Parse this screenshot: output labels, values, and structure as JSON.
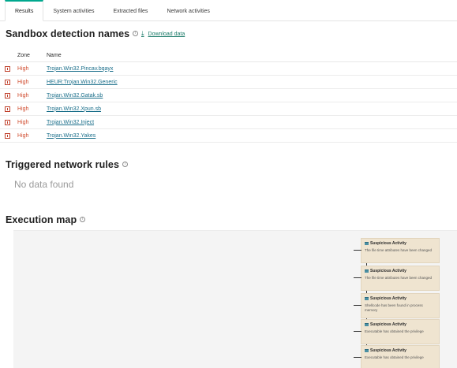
{
  "tabs": [
    "Results",
    "System activities",
    "Extracted files",
    "Network activities"
  ],
  "active_tab": "Results",
  "detections": {
    "title": "Sandbox detection names",
    "download_label": "Download data",
    "columns": [
      "Zone",
      "Name"
    ],
    "rows": [
      {
        "zone": "High",
        "name": "Trojan.Win32.Pincav.bqayx"
      },
      {
        "zone": "High",
        "name": "HEUR:Trojan.Win32.Generic"
      },
      {
        "zone": "High",
        "name": "Trojan.Win32.Gatak.sb"
      },
      {
        "zone": "High",
        "name": "Trojan.Win32.Xpun.sb"
      },
      {
        "zone": "High",
        "name": "Trojan.Win32.Inject"
      },
      {
        "zone": "High",
        "name": "Trojan.Win32.Yakes"
      }
    ]
  },
  "network_rules": {
    "title": "Triggered network rules",
    "empty_text": "No data found"
  },
  "execution_map": {
    "title": "Execution map",
    "cards": [
      {
        "title": "Suspicious Activity",
        "desc": "The file time attributes have been changed"
      },
      {
        "title": "Suspicious Activity",
        "desc": "The file time attributes have been changed"
      },
      {
        "title": "Suspicious Activity",
        "desc": "Shellcode has been found in process memory"
      },
      {
        "title": "Suspicious Activity",
        "desc": "Executable has obtained the privilege"
      },
      {
        "title": "Suspicious Activity",
        "desc": "Executable has obtained the privilege"
      }
    ]
  },
  "colors": {
    "accent": "#00a88e",
    "high": "#d04a2c",
    "link": "#1a6e8a",
    "card_bg": "#efe4d0"
  }
}
